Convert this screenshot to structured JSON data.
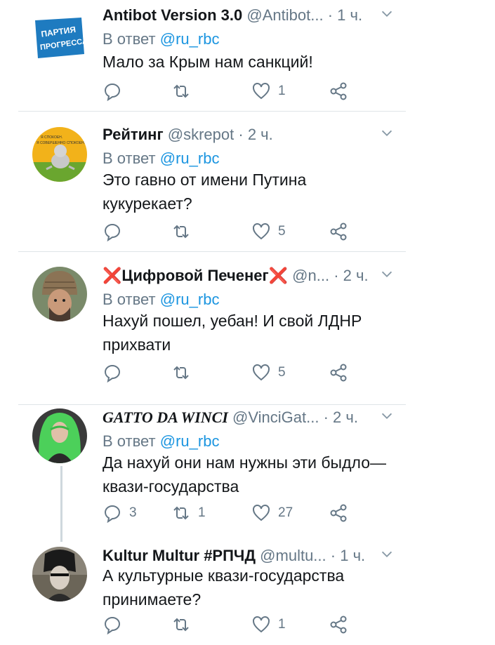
{
  "tweets": [
    {
      "name": "Antibot Version 3.0",
      "handle": "@Antibot...",
      "time": "1 ч.",
      "dot": "·",
      "reply_prefix": "В ответ",
      "reply_mention": "@ru_rbc",
      "text": "Мало за Крым нам санкций!",
      "replies": "",
      "retweets": "",
      "likes": "1",
      "avatar_text": "ПАРТИЯ ПРОГРЕССА"
    },
    {
      "name": "Рейтинг",
      "handle": "@skrepot",
      "time": "2 ч.",
      "dot": "·",
      "reply_prefix": "В ответ",
      "reply_mention": "@ru_rbc",
      "text": "Это гавно от имени Путина кукурекает?",
      "replies": "",
      "retweets": "",
      "likes": "5",
      "avatar_text": "Я СПОКОЕН. Я СОВЕРШЕННО СПОКОЕН."
    },
    {
      "name_prefix": "❌",
      "name": "Цифровой Печенег",
      "name_suffix": "❌",
      "handle": "@n...",
      "time": "2 ч.",
      "dot": "·",
      "reply_prefix": "В ответ",
      "reply_mention": "@ru_rbc",
      "text": "Нахуй пошел, уебан! И свой ЛДНР прихвати",
      "replies": "",
      "retweets": "",
      "likes": "5"
    },
    {
      "name": "GATTO DA WINCI",
      "handle": "@VinciGat...",
      "time": "2 ч.",
      "dot": "·",
      "reply_prefix": "В ответ",
      "reply_mention": "@ru_rbc",
      "text": "Да нахуй они нам нужны эти быдло—квази-государства",
      "replies": "3",
      "retweets": "1",
      "likes": "27"
    },
    {
      "name": "Kultur Multur #РПЧД",
      "handle": "@multu...",
      "time": "1 ч.",
      "dot": "·",
      "reply_prefix": "",
      "reply_mention": "",
      "text": "А культурные квази-государства принимаете?",
      "replies": "",
      "retweets": "",
      "likes": "1"
    }
  ],
  "icons": {
    "reply": "reply-icon",
    "retweet": "retweet-icon",
    "like": "heart-icon",
    "share": "share-icon",
    "menu": "chevron-down-icon"
  },
  "colors": {
    "link": "#1b95e0",
    "secondary": "#657786",
    "divider": "#dfe4e8",
    "alert": "#e0245e"
  }
}
